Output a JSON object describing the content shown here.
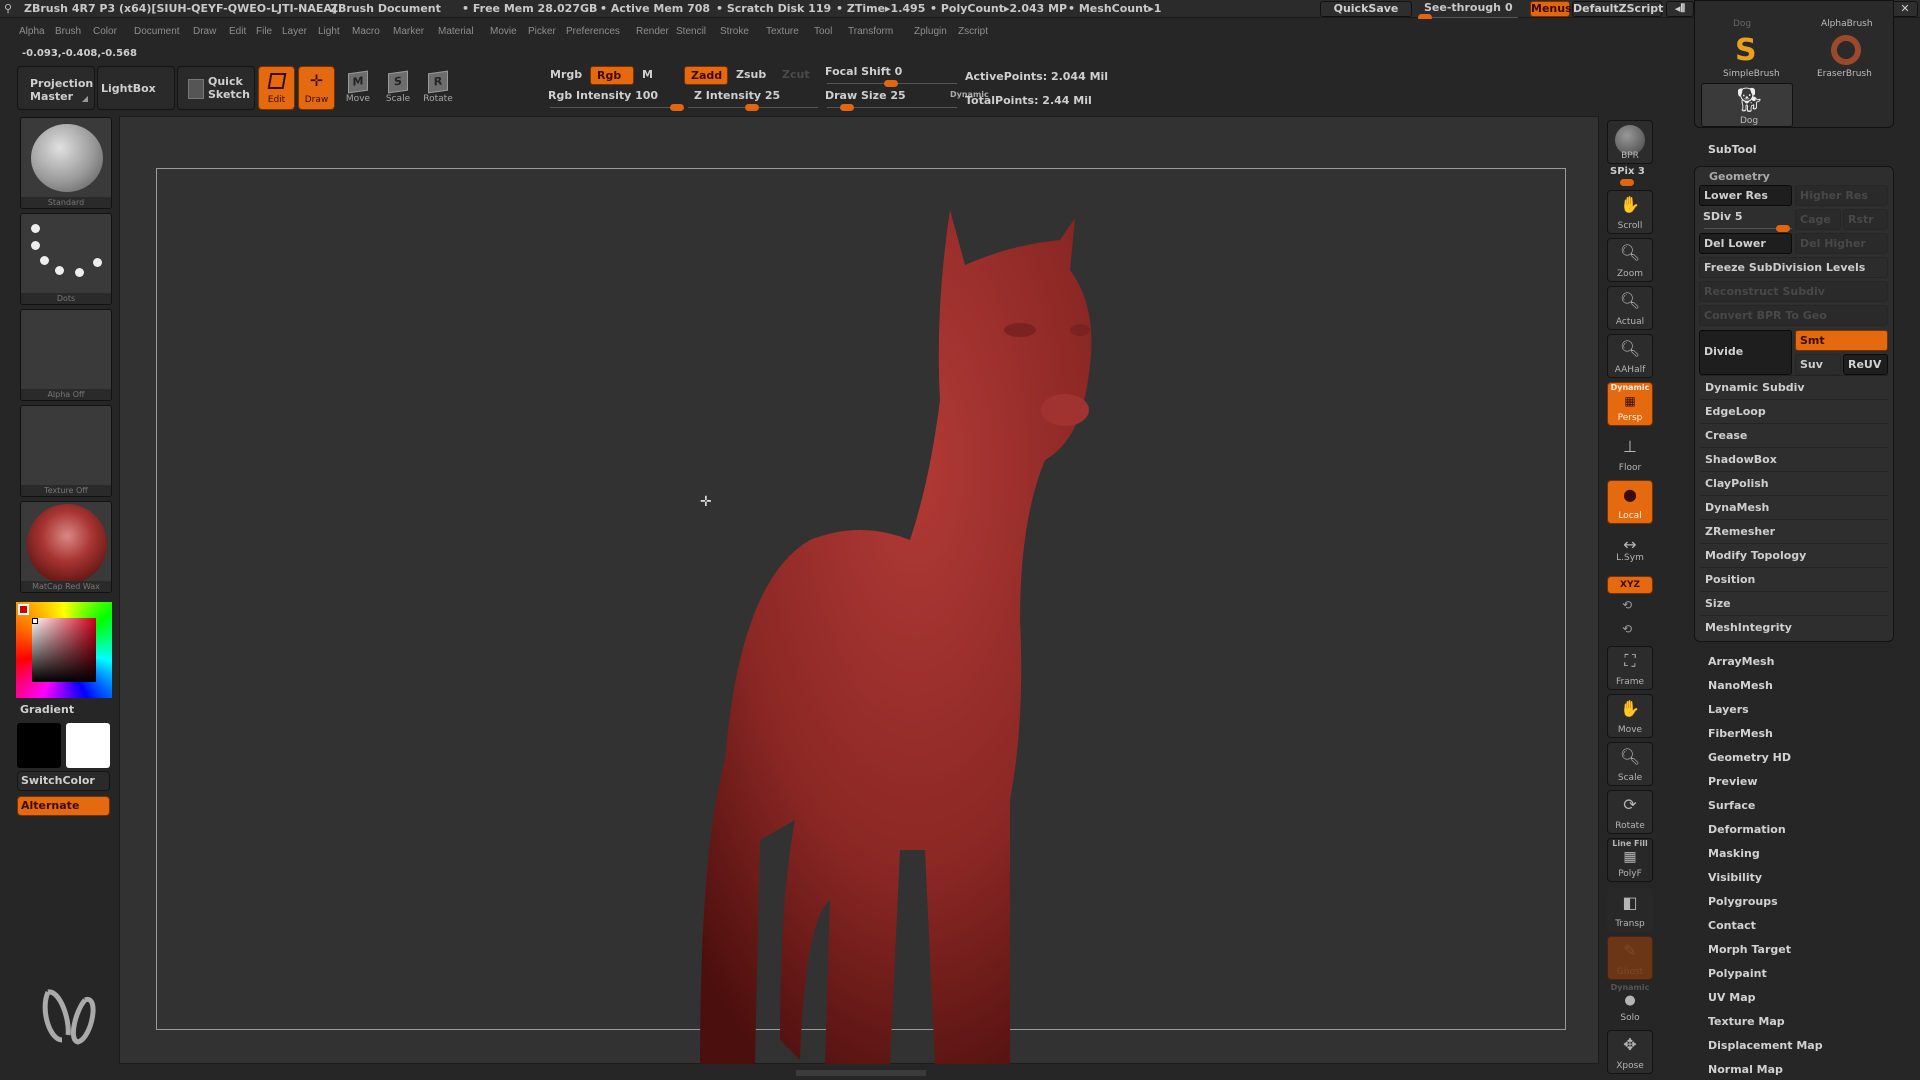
{
  "titlebar": {
    "app": "ZBrush 4R7 P3 (x64)[SIUH-QEYF-QWEO-LJTI-NAEA]",
    "document": "ZBrush Document",
    "free_mem": "• Free Mem 28.027GB",
    "active_mem": "• Active Mem 708",
    "scratch_disk": "• Scratch Disk 119",
    "ztime": "• ZTime▸1.495",
    "polycount": "• PolyCount▸2.043 MP",
    "meshcount": "• MeshCount▸1",
    "quicksave": "QuickSave",
    "see_through_label": "See-through",
    "see_through_value": "0",
    "see_through_fraction": 0.0,
    "menus": "Menus",
    "script": "DefaultZScript"
  },
  "menubar": [
    "Alpha",
    "Brush",
    "Color",
    "Document",
    "Draw",
    "Edit",
    "File",
    "Layer",
    "Light",
    "Macro",
    "Marker",
    "Material",
    "Movie",
    "Picker",
    "Preferences",
    "Render",
    "Stencil",
    "Stroke",
    "Texture",
    "Tool",
    "Transform",
    "Zplugin",
    "Zscript"
  ],
  "coords": "-0.093,-0.408,-0.568",
  "toolbar": {
    "projection_master": "Projection Master",
    "lightbox": "LightBox",
    "quick_sketch": "Quick Sketch",
    "edit": "Edit",
    "draw": "Draw",
    "move": "Move",
    "scale": "Scale",
    "rotate": "Rotate",
    "mrgb": "Mrgb",
    "rgb": "Rgb",
    "m": "M",
    "zadd": "Zadd",
    "zsub": "Zsub",
    "zcut": "Zcut",
    "rgb_intensity_label": "Rgb Intensity 100",
    "rgb_intensity": 100,
    "z_intensity_label": "Z Intensity 25",
    "z_intensity": 25,
    "focal_shift_label": "Focal Shift 0",
    "focal_shift": 0,
    "draw_size_label": "Draw Size 25",
    "draw_size": 25,
    "dynamic": "Dynamic",
    "active_points": "ActivePoints: 2.044 Mil",
    "total_points": "TotalPoints: 2.44 Mil"
  },
  "left_shelf": {
    "brush": "Standard",
    "stroke": "Dots",
    "alpha": "Alpha Off",
    "texture": "Texture Off",
    "material": "MatCap Red Wax",
    "gradient": "Gradient",
    "switch_color": "SwitchColor",
    "alternate": "Alternate",
    "main_color": "#000000",
    "secondary_color": "#ffffff"
  },
  "right_shelf": {
    "bpr": "BPR",
    "spix": "SPix 3",
    "scroll": "Scroll",
    "zoom": "Zoom",
    "actual": "Actual",
    "aahalf": "AAHalf",
    "persp_top": "Dynamic",
    "persp": "Persp",
    "floor": "Floor",
    "local": "Local",
    "lsym": "L.Sym",
    "xyz": "XYZ",
    "frame": "Frame",
    "move": "Move",
    "scale": "Scale",
    "rotate": "Rotate",
    "polyf_top": "Line Fill",
    "polyf": "PolyF",
    "transp": "Transp",
    "ghost": "Ghost",
    "solo_top": "Dynamic",
    "solo": "Solo",
    "xpose": "Xpose"
  },
  "tray": {
    "top_labels": [
      "Dog",
      "AlphaBrush"
    ],
    "brushes": [
      "SimpleBrush",
      "EraserBrush",
      "Dog"
    ],
    "subtool": "SubTool",
    "geometry": {
      "title": "Geometry",
      "lower_res": "Lower Res",
      "higher_res": "Higher Res",
      "sdiv": "SDiv 5",
      "cage": "Cage",
      "rstr": "Rstr",
      "del_lower": "Del Lower",
      "del_higher": "Del Higher",
      "freeze": "Freeze SubDivision Levels",
      "reconstruct": "Reconstruct Subdiv",
      "convert_bpr": "Convert BPR To Geo",
      "divide": "Divide",
      "smt": "Smt",
      "suv": "Suv",
      "reuv": "ReUV",
      "subitems": [
        "Dynamic Subdiv",
        "EdgeLoop",
        "Crease",
        "ShadowBox",
        "ClayPolish",
        "DynaMesh",
        "ZRemesher",
        "Modify Topology",
        "Position",
        "Size",
        "MeshIntegrity"
      ]
    },
    "tool_items": [
      "ArrayMesh",
      "NanoMesh",
      "Layers",
      "FiberMesh",
      "Geometry HD",
      "Preview",
      "Surface",
      "Deformation",
      "Masking",
      "Visibility",
      "Polygroups",
      "Contact",
      "Morph Target",
      "Polypaint",
      "UV Map",
      "Texture Map",
      "Displacement Map",
      "Normal Map"
    ]
  },
  "colors": {
    "accent": "#e5690f",
    "model": "#8e2a26"
  }
}
